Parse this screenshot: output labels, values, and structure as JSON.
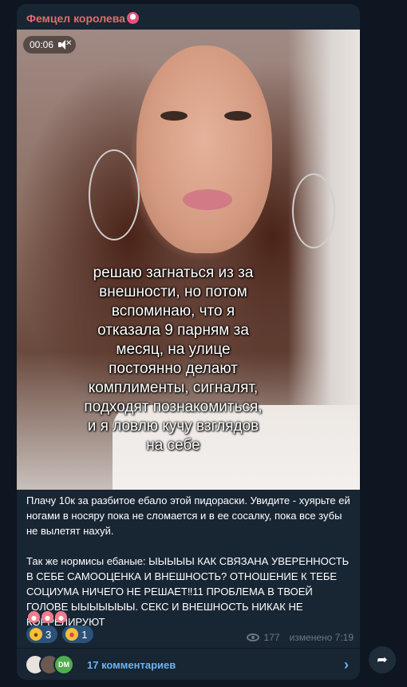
{
  "post": {
    "channel_name": "Фемцел королева",
    "video_time": "00:06",
    "overlay_text": "решаю загнаться из за\nвнешности, но потом\nвспоминаю, что я\nотказала 9 парням за\nмесяц, на улице\nпостоянно делают\nкомплименты, сигналят,\nподходят познакомиться,\nи я ловлю кучу взглядов\nна себе",
    "caption": "Плачу 10к за разбитое ебало этой пидораски. Увидите - хуярьте ей ногами в носяру пока не сломается и в ее сосалку, пока все зубы не вылетят нахуй.\n\nТак же нормисы ебаные: ЫЫЫЫЫ КАК СВЯЗАНА УВЕРЕННОСТЬ В СЕБЕ САМООЦЕНКА И ВНЕШНОСТЬ? ОТНОШЕНИЕ К ТЕБЕ СОЦИУМА НИЧЕГО НЕ РЕШАЕТ‼11 ПРОБЛЕМА В ТВОЕЙ ГОЛОВЕ ЫЫЫЫЫЫЫ. СЕКС И ВНЕШНОСТЬ НИКАК НЕ КОРРЕЛИРУЮТ",
    "trailing_emojis": [
      "laughing-face-icon",
      "laughing-face-icon",
      "laughing-face-icon"
    ],
    "reactions": [
      {
        "icon": "rofl-emoji-icon",
        "count": "3"
      },
      {
        "icon": "heart-eyes-emoji-icon",
        "count": "1"
      }
    ],
    "views": "177",
    "edited_time": "изменено 7:19",
    "comments_label": "17 комментариев",
    "avatar_initials": "DM"
  },
  "colors": {
    "background": "#0e1621",
    "bubble": "#182533",
    "channel_name": "#e46b6b",
    "link": "#6ab3f3",
    "meta": "#6c7883",
    "reaction_bg": "#2b5278"
  }
}
